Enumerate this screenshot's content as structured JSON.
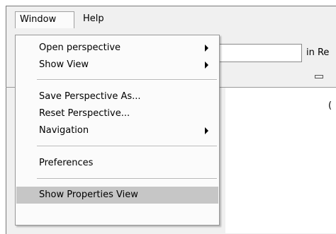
{
  "menubar": {
    "window_label": "Window",
    "help_label": "Help"
  },
  "background": {
    "in_re_text": "in Re",
    "paren_text": "("
  },
  "window_menu": {
    "items": [
      {
        "label": "Open perspective",
        "submenu": true
      },
      {
        "label": "Show View",
        "submenu": true
      },
      {
        "label": "Save Perspective As...",
        "submenu": false
      },
      {
        "label": "Reset Perspective...",
        "submenu": false
      },
      {
        "label": "Navigation",
        "submenu": true
      },
      {
        "label": "Preferences",
        "submenu": false
      },
      {
        "label": "Show Properties View",
        "submenu": false,
        "highlighted": true
      }
    ]
  },
  "colors": {
    "menu_background": "#fbfbfb",
    "highlight": "#c6c6c6",
    "frame": "#f0f0f0"
  }
}
